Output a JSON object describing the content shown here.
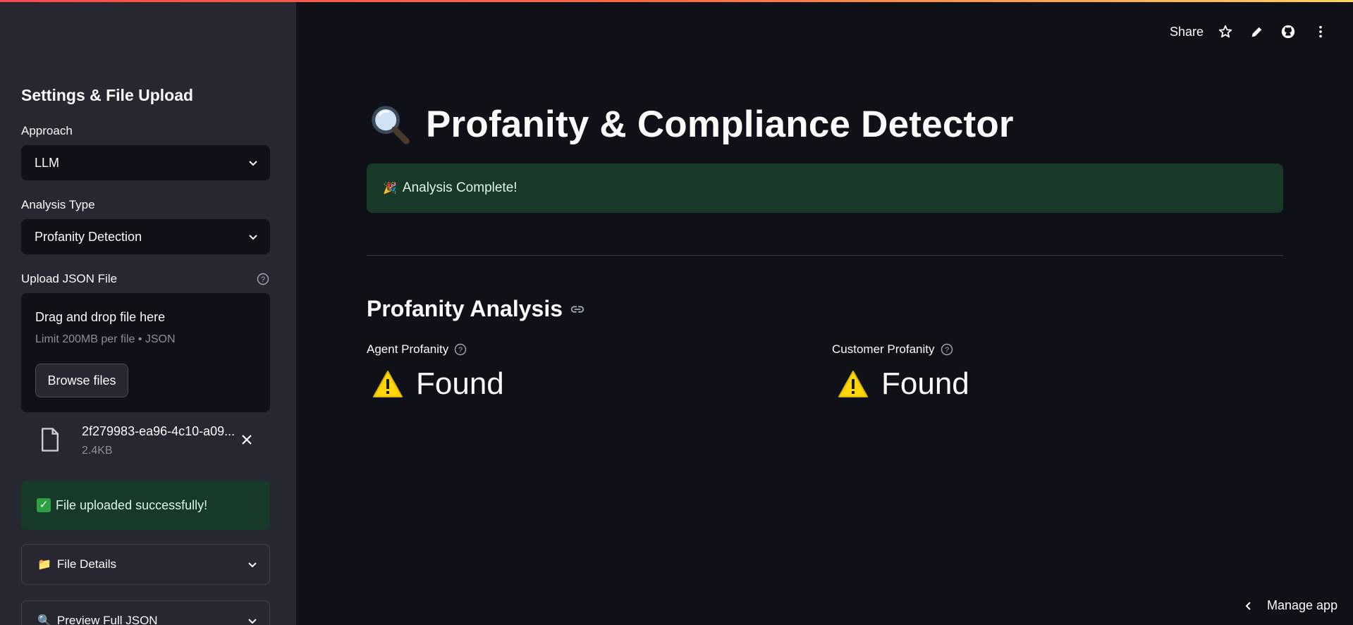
{
  "header": {
    "share_label": "Share",
    "icons": [
      "star-icon",
      "pencil-icon",
      "github-icon",
      "more-vert-icon"
    ]
  },
  "sidebar": {
    "title": "Settings & File Upload",
    "approach": {
      "label": "Approach",
      "value": "LLM"
    },
    "analysis_type": {
      "label": "Analysis Type",
      "value": "Profanity Detection"
    },
    "upload": {
      "label": "Upload JSON File",
      "drop_title": "Drag and drop file here",
      "drop_subtitle": "Limit 200MB per file • JSON",
      "browse_label": "Browse files",
      "file_name": "2f279983-ea96-4c10-a09...",
      "file_size": "2.4KB"
    },
    "success_message": "File uploaded successfully!",
    "expanders": [
      {
        "emoji": "📁",
        "label": "File Details"
      },
      {
        "emoji": "🔍",
        "label": "Preview Full JSON"
      }
    ]
  },
  "main": {
    "title": "Profanity & Compliance Detector",
    "alert": {
      "emoji": "🎉",
      "text": "Analysis Complete!"
    },
    "section_title": "Profanity Analysis",
    "metrics": [
      {
        "label": "Agent Profanity",
        "value": "Found"
      },
      {
        "label": "Customer Profanity",
        "value": "Found"
      }
    ]
  },
  "footer": {
    "manage_label": "Manage app"
  },
  "colors": {
    "background": "#0e1117",
    "sidebar": "#262730",
    "success_bg": "#173928",
    "warning": "#ffd60a",
    "accent_gradient": [
      "#ff4b4b",
      "#ffd25a"
    ]
  }
}
